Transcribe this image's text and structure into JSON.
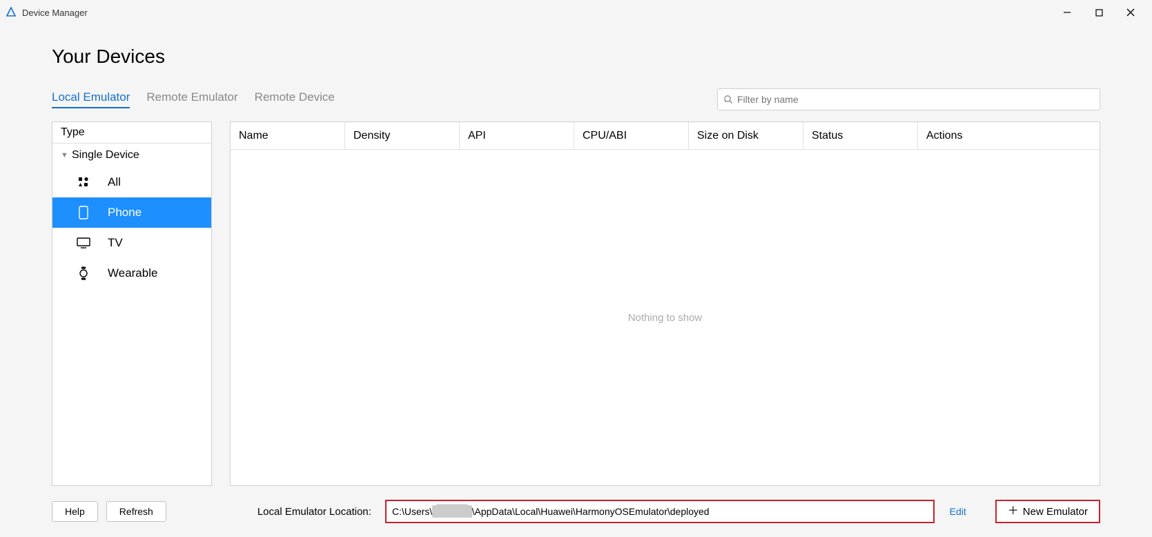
{
  "window": {
    "title": "Device Manager"
  },
  "page": {
    "title": "Your Devices"
  },
  "tabs": {
    "local": "Local Emulator",
    "remote_emu": "Remote Emulator",
    "remote_dev": "Remote Device",
    "active_index": 0
  },
  "search": {
    "placeholder": "Filter by name",
    "value": ""
  },
  "sidebar": {
    "header": "Type",
    "group_label": "Single Device",
    "items": [
      {
        "key": "all",
        "label": "All",
        "selected": false
      },
      {
        "key": "phone",
        "label": "Phone",
        "selected": true
      },
      {
        "key": "tv",
        "label": "TV",
        "selected": false
      },
      {
        "key": "wearable",
        "label": "Wearable",
        "selected": false
      }
    ]
  },
  "table": {
    "columns": {
      "name": "Name",
      "density": "Density",
      "api": "API",
      "cpu": "CPU/ABI",
      "size": "Size on Disk",
      "status": "Status",
      "actions": "Actions"
    },
    "empty_text": "Nothing to show",
    "rows": []
  },
  "footer": {
    "help_label": "Help",
    "refresh_label": "Refresh",
    "location_label": "Local Emulator Location:",
    "location_prefix": "C:\\Users\\",
    "location_redacted": "████",
    "location_suffix": "\\AppData\\Local\\Huawei\\HarmonyOSEmulator\\deployed",
    "edit_label": "Edit",
    "new_emulator_label": "New Emulator"
  }
}
